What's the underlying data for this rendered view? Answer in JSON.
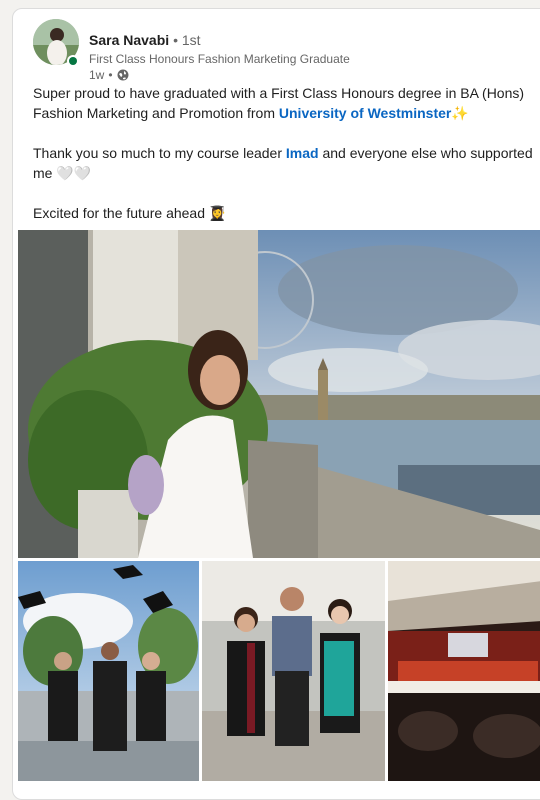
{
  "post": {
    "author": {
      "name": "Sara Navabi",
      "separator": "•",
      "degree": "1st",
      "headline": "First Class Honours Fashion Marketing Graduate",
      "time": "1w",
      "meta_separator": "•",
      "visibility_icon": "globe-icon"
    },
    "more_icon": "⋮",
    "text": {
      "p1_a": "Super proud to have graduated with a First Class Honours degree in BA (Hons) Fashion Marketing and Promotion from ",
      "p1_mention": "University of Westminster",
      "p1_emoji": "✨",
      "p2_a": "Thank you so much to my course leader ",
      "p2_mention": "Imad",
      "p2_b": " and everyone else who supported me ",
      "p2_emoji": "🤍🤍",
      "p3_a": "Excited for the future ahead ",
      "p3_emoji": "👩‍🎓"
    },
    "images": [
      "graduate-balcony-photo",
      "caps-toss-photo",
      "group-with-lecturer-photo",
      "ceremony-hall-photo"
    ]
  },
  "colors": {
    "link": "#0a66c2",
    "online": "#057642",
    "muted": "#666666"
  }
}
